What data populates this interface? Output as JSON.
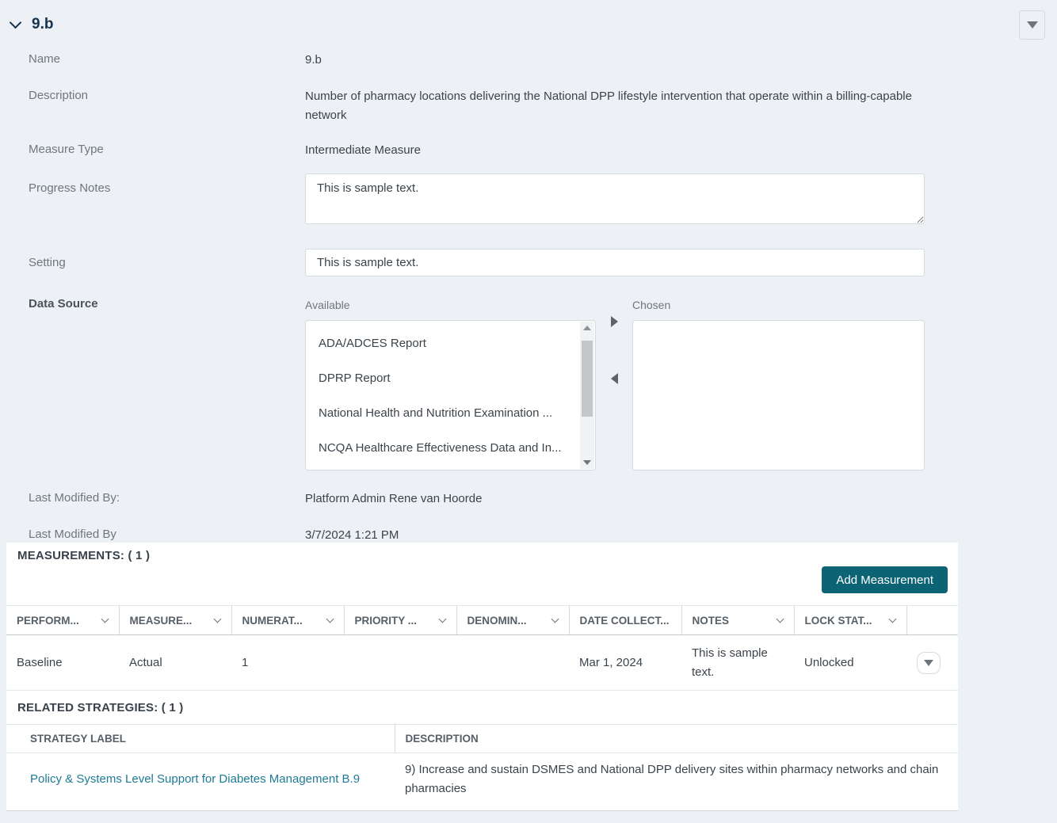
{
  "colors": {
    "page_background": "#edf1f5",
    "panel_background": "#ffffff",
    "accent_button": "#0c6374",
    "link": "#1e7b95",
    "title_navy": "#17334f",
    "label_gray": "#6f767d",
    "text_dark": "#3b434b"
  },
  "header": {
    "title": "9.b"
  },
  "form": {
    "name": {
      "label": "Name",
      "value": "9.b"
    },
    "description": {
      "label": "Description",
      "value": "Number of pharmacy locations delivering the National DPP lifestyle intervention that operate within a billing-capable network"
    },
    "measure_type": {
      "label": "Measure Type",
      "value": "Intermediate Measure"
    },
    "progress_notes": {
      "label": "Progress Notes",
      "value": "This is sample text."
    },
    "setting": {
      "label": "Setting",
      "value": "This is sample text."
    },
    "data_source": {
      "label": "Data Source",
      "available_label": "Available",
      "chosen_label": "Chosen",
      "available_items": [
        "ADA/ADCES Report",
        "DPRP Report",
        "National Health and Nutrition Examination ...",
        "NCQA Healthcare Effectiveness Data and In..."
      ],
      "chosen_items": []
    },
    "last_modified_by_name": {
      "label": "Last Modified By:",
      "value": "Platform Admin Rene van Hoorde"
    },
    "last_modified_by_date": {
      "label": "Last Modified By",
      "value": "3/7/2024 1:21 PM"
    }
  },
  "measurements": {
    "section_title": "MEASUREMENTS: ( 1 )",
    "add_button_label": "Add Measurement",
    "columns": [
      "PERFORM...",
      "MEASURE...",
      "NUMERAT...",
      "PRIORITY ...",
      "DENOMIN...",
      "DATE COLLECT...",
      "NOTES",
      "LOCK STAT..."
    ],
    "rows": [
      {
        "performance": "Baseline",
        "measure": "Actual",
        "numerator": "1",
        "priority": "",
        "denominator": "",
        "date_collected": "Mar 1, 2024",
        "notes": "This is sample text.",
        "lock_status": "Unlocked"
      }
    ]
  },
  "related_strategies": {
    "section_title": "RELATED STRATEGIES: ( 1 )",
    "columns": {
      "strategy_label": "STRATEGY LABEL",
      "description": "DESCRIPTION"
    },
    "rows": [
      {
        "strategy_label": "Policy & Systems Level Support for Diabetes Management B.9",
        "description": "9) Increase and sustain DSMES and National DPP delivery sites within pharmacy networks and chain pharmacies"
      }
    ]
  }
}
